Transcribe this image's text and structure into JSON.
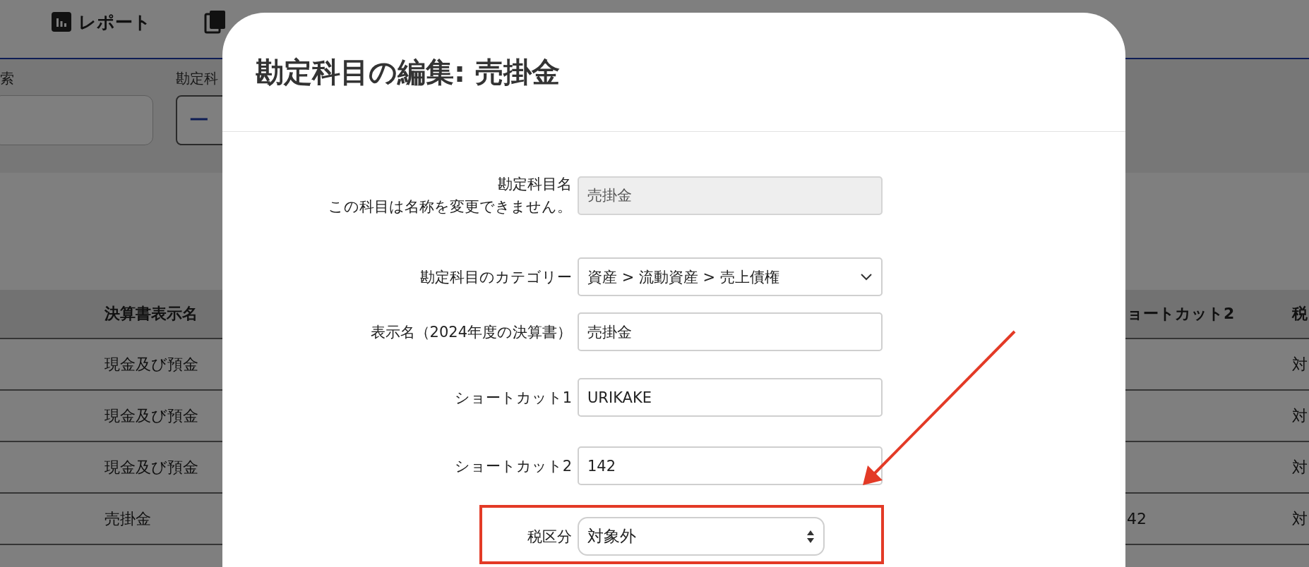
{
  "nav": {
    "items": [
      {
        "kind": "report",
        "label": "レポート"
      },
      {
        "kind": "document"
      }
    ]
  },
  "filters": [
    {
      "kind": "text",
      "label": "索"
    },
    {
      "kind": "select",
      "label": "勘定科",
      "value": "一"
    }
  ],
  "table": {
    "columns": [
      "決算書表示名",
      "ョートカット2",
      "税"
    ],
    "rows": [
      {
        "display_name": "現金及び預金",
        "tax": "対"
      },
      {
        "display_name": "現金及び預金",
        "tax": "対"
      },
      {
        "display_name": "現金及び預金",
        "tax": "対"
      },
      {
        "display_name": "売掛金",
        "shortcut2": "42",
        "tax": "対"
      }
    ]
  },
  "modal": {
    "title": "勘定科目の編集: 売掛金",
    "fields": [
      {
        "kind": "text",
        "label": "勘定科目名",
        "note": "この科目は名称を変更できません。",
        "value": "売掛金",
        "disabled": true,
        "highlighted": false
      },
      {
        "kind": "select",
        "label": "勘定科目のカテゴリー",
        "value": "資産 > 流動資産 > 売上債権",
        "disabled": false,
        "highlighted": false
      },
      {
        "kind": "text",
        "label": "表示名（2024年度の決算書）",
        "value": "売掛金",
        "disabled": false,
        "highlighted": false
      },
      {
        "kind": "text",
        "label": "ショートカット1",
        "value": "URIKAKE",
        "disabled": false,
        "highlighted": false
      },
      {
        "kind": "text",
        "label": "ショートカット2",
        "value": "142",
        "disabled": false,
        "highlighted": false
      },
      {
        "kind": "stepper",
        "label": "税区分",
        "value": "対象外",
        "disabled": false,
        "highlighted": true
      }
    ]
  }
}
